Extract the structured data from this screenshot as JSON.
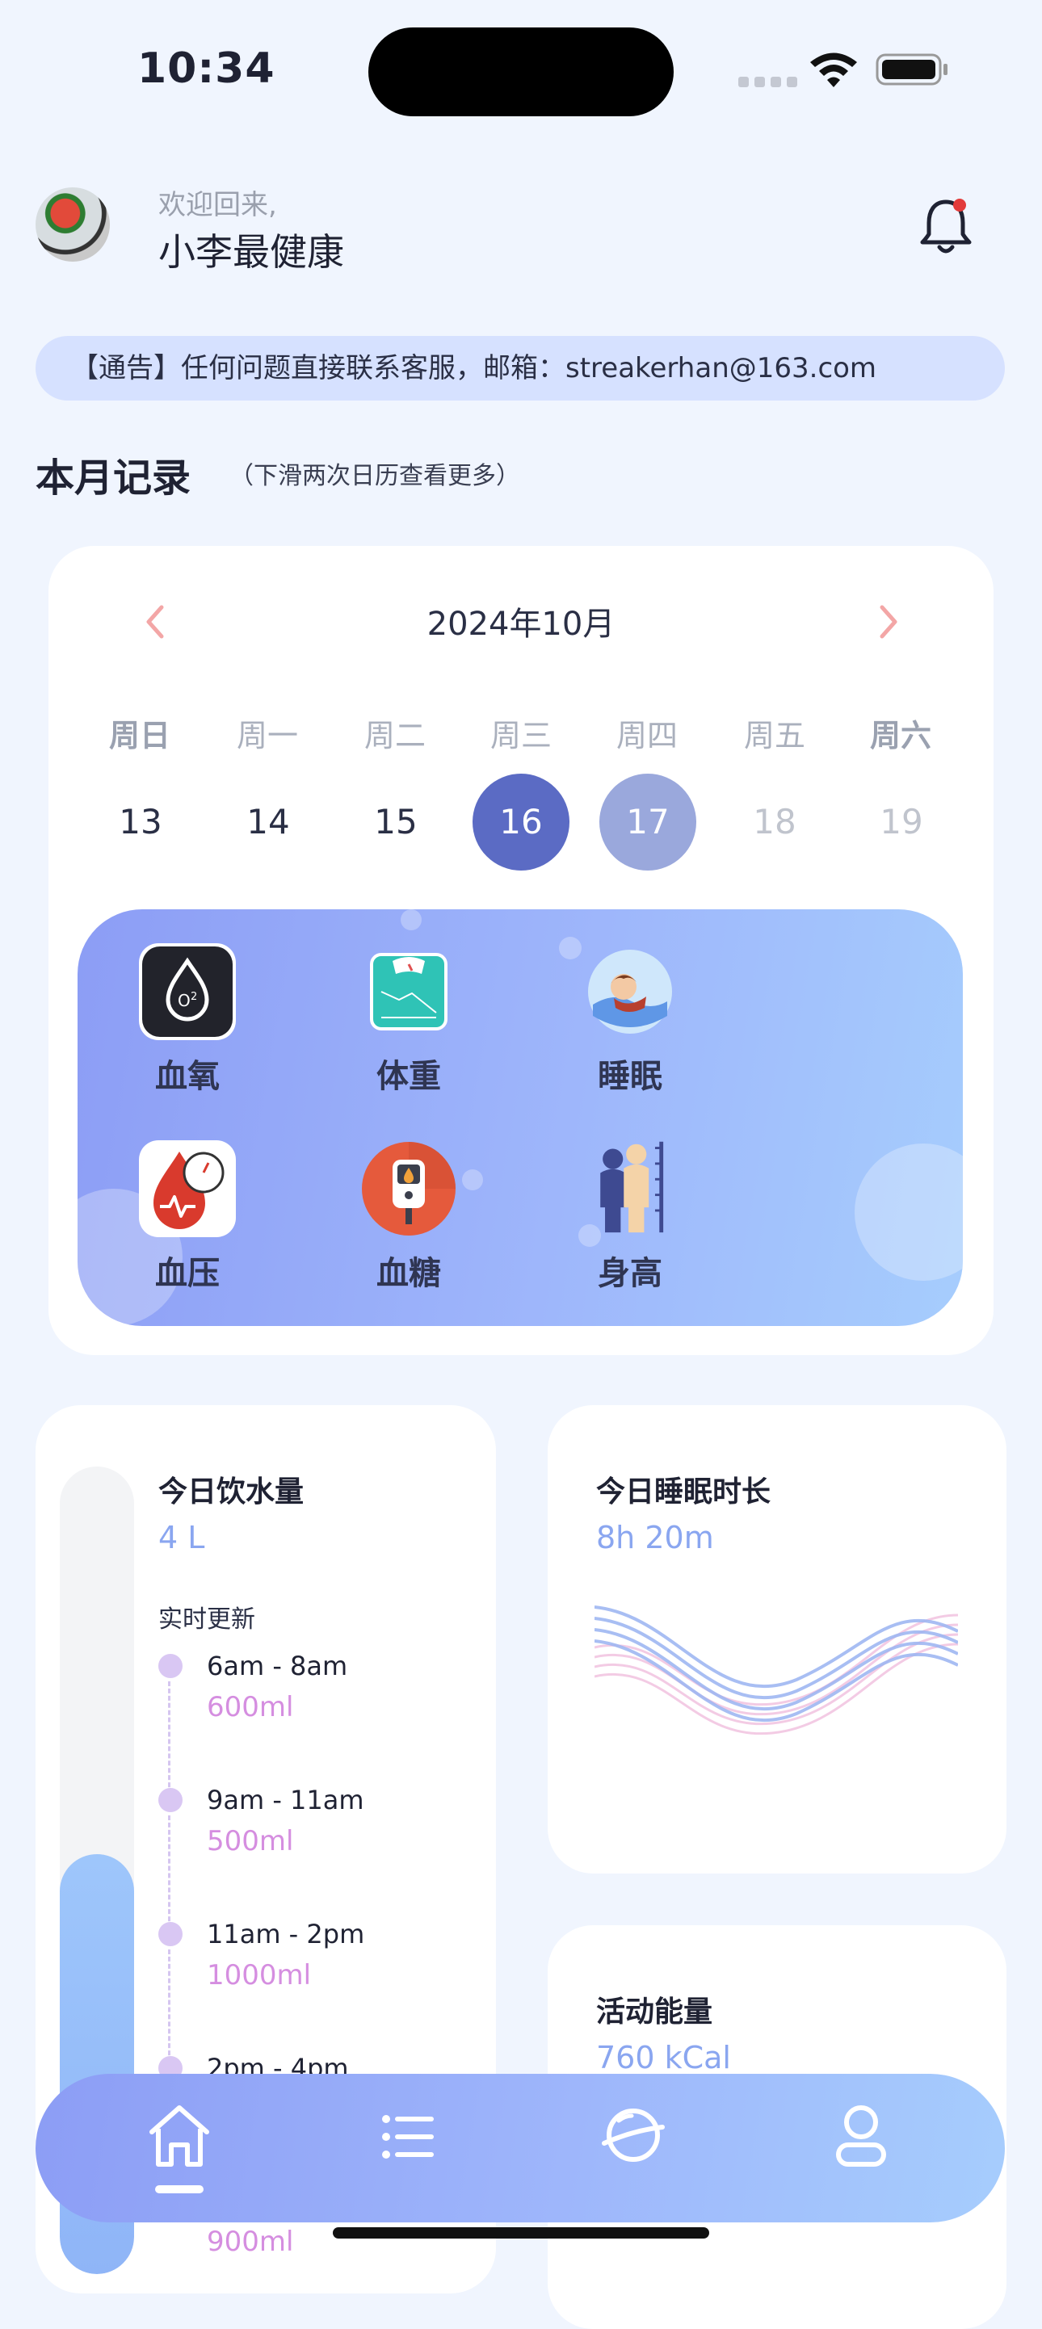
{
  "status_bar": {
    "time": "10:34"
  },
  "header": {
    "welcome": "欢迎回来,",
    "username": "小李最健康"
  },
  "notice": {
    "text": "【通告】任何问题直接联系客服，邮箱：streakerhan@163.com"
  },
  "section": {
    "title": "本月记录",
    "hint": "（下滑两次日历查看更多）"
  },
  "calendar": {
    "month": "2024年10月",
    "weekdays": [
      "周日",
      "周一",
      "周二",
      "周三",
      "周四",
      "周五",
      "周六"
    ],
    "days": [
      "13",
      "14",
      "15",
      "16",
      "17",
      "18",
      "19"
    ],
    "selected_day": "16",
    "secondary_day": "17"
  },
  "features": [
    {
      "label": "血氧",
      "icon": "blood-oxygen-icon"
    },
    {
      "label": "体重",
      "icon": "scale-icon"
    },
    {
      "label": "睡眠",
      "icon": "sleep-icon"
    },
    {
      "label": "血压",
      "icon": "blood-pressure-icon"
    },
    {
      "label": "血糖",
      "icon": "glucose-meter-icon"
    },
    {
      "label": "身高",
      "icon": "height-icon"
    }
  ],
  "water": {
    "title": "今日饮水量",
    "value": "4 L",
    "update_label": "实时更新",
    "fill_fraction": 0.52,
    "timeline": [
      {
        "slot": "6am - 8am",
        "amount": "600ml"
      },
      {
        "slot": "9am - 11am",
        "amount": "500ml"
      },
      {
        "slot": "11am - 2pm",
        "amount": "1000ml"
      },
      {
        "slot": "2pm - 4pm",
        "amount": "900ml"
      }
    ]
  },
  "sleep": {
    "title": "今日睡眠时长",
    "value": "8h 20m"
  },
  "energy": {
    "title": "活动能量",
    "value": "760 kCal",
    "gauge_label": "left"
  },
  "nav": {
    "items": [
      {
        "name": "home",
        "icon": "home-icon",
        "active": true
      },
      {
        "name": "list",
        "icon": "list-icon",
        "active": false
      },
      {
        "name": "explore",
        "icon": "planet-icon",
        "active": false
      },
      {
        "name": "profile",
        "icon": "user-icon",
        "active": false
      }
    ]
  },
  "colors": {
    "accent": "#5b6bc4",
    "panel_start": "#8c9df5",
    "panel_end": "#a6cdfd",
    "amount": "#d58ee0"
  }
}
